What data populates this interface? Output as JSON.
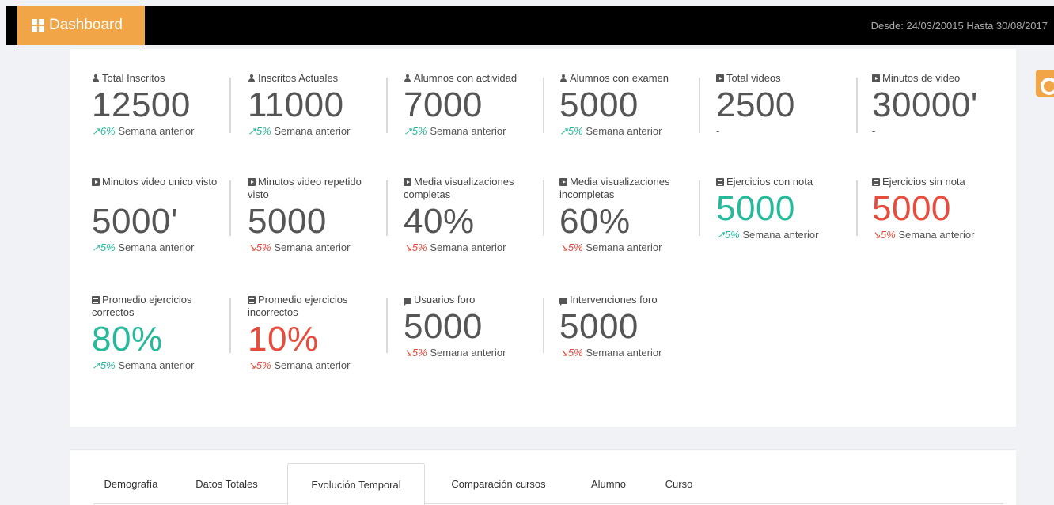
{
  "header": {
    "title": "Dashboard",
    "date_range": "Desde: 24/03/20015 Hasta 30/08/2017",
    "colors": {
      "brand": "#f1a546",
      "bar": "#000000"
    }
  },
  "stats": [
    {
      "label": "Total Inscritos",
      "icon": "user-icon",
      "value": "12500",
      "trend_pct": "6%",
      "trend_dir": "up",
      "trend_text": "Semana anterior"
    },
    {
      "label": "Inscritos Actuales",
      "icon": "user-icon",
      "value": "11000",
      "trend_pct": "5%",
      "trend_dir": "up",
      "trend_text": "Semana anterior"
    },
    {
      "label": "Alumnos con actividad",
      "icon": "user-icon",
      "value": "7000",
      "trend_pct": "5%",
      "trend_dir": "up",
      "trend_text": "Semana anterior"
    },
    {
      "label": "Alumnos con examen",
      "icon": "user-icon",
      "value": "5000",
      "trend_pct": "5%",
      "trend_dir": "up",
      "trend_text": "Semana anterior"
    },
    {
      "label": "Total videos",
      "icon": "video-icon",
      "value": "2500",
      "trend_text": "-"
    },
    {
      "label": "Minutos de video",
      "icon": "video-icon",
      "value": "30000'",
      "trend_text": "-"
    },
    {
      "label": "Minutos video unico visto",
      "icon": "video-icon",
      "value": "5000'",
      "trend_pct": "5%",
      "trend_dir": "up",
      "trend_text": "Semana anterior"
    },
    {
      "label": "Minutos video repetido visto",
      "icon": "video-icon",
      "value": "5000",
      "trend_pct": "5%",
      "trend_dir": "down",
      "trend_text": "Semana anterior"
    },
    {
      "label": "Media visualizaciones completas",
      "icon": "video-icon",
      "value": "40%",
      "trend_pct": "5%",
      "trend_dir": "down",
      "trend_text": "Semana anterior"
    },
    {
      "label": "Media visualizaciones incompletas",
      "icon": "video-icon",
      "value": "60%",
      "trend_pct": "5%",
      "trend_dir": "down",
      "trend_text": "Semana anterior"
    },
    {
      "label": "Ejercicios con nota",
      "icon": "clipboard-icon",
      "value": "5000",
      "value_color": "#26b99a",
      "trend_pct": "5%",
      "trend_dir": "up",
      "trend_text": "Semana anterior"
    },
    {
      "label": "Ejercicios sin nota",
      "icon": "clipboard-icon",
      "value": "5000",
      "value_color": "#e74c3c",
      "trend_pct": "5%",
      "trend_dir": "down",
      "trend_text": "Semana anterior"
    },
    {
      "label": "Promedio ejercicios correctos",
      "icon": "clipboard-icon",
      "value": "80%",
      "value_color": "#26b99a",
      "trend_pct": "5%",
      "trend_dir": "up",
      "trend_text": "Semana anterior"
    },
    {
      "label": "Promedio ejercicios incorrectos",
      "icon": "clipboard-icon",
      "value": "10%",
      "value_color": "#e74c3c",
      "trend_pct": "5%",
      "trend_dir": "down",
      "trend_text": "Semana anterior"
    },
    {
      "label": "Usuarios foro",
      "icon": "chat-icon",
      "value": "5000",
      "trend_pct": "5%",
      "trend_dir": "down",
      "trend_text": "Semana anterior"
    },
    {
      "label": "Intervenciones foro",
      "icon": "chat-icon",
      "value": "5000",
      "trend_pct": "5%",
      "trend_dir": "down",
      "trend_text": "Semana anterior"
    }
  ],
  "tabs": [
    {
      "label": "Demografía",
      "active": false
    },
    {
      "label": "Datos Totales",
      "active": false
    },
    {
      "label": "Evolución Temporal",
      "active": true
    },
    {
      "label": "Comparación cursos",
      "active": false
    },
    {
      "label": "Alumno",
      "active": false
    },
    {
      "label": "Curso",
      "active": false
    }
  ]
}
